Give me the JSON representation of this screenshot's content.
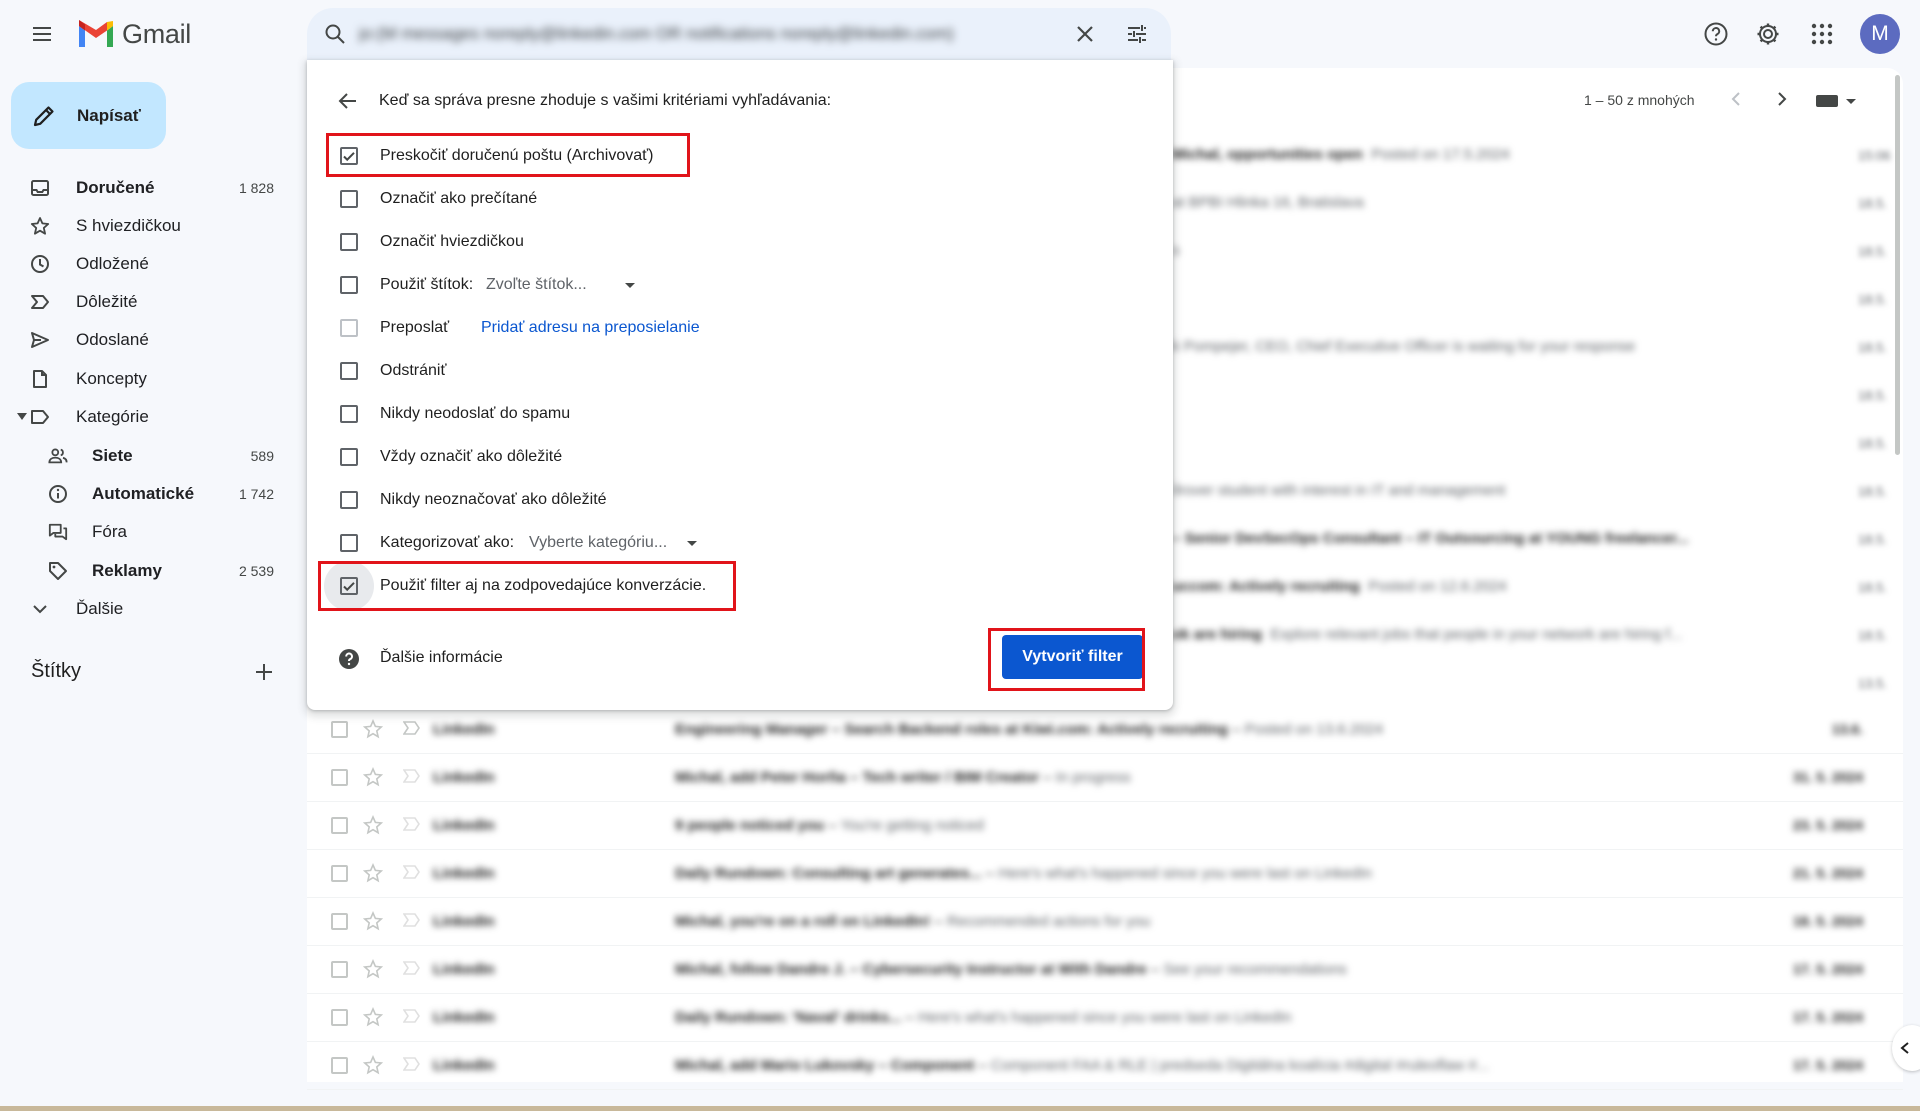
{
  "app": {
    "name": "Gmail",
    "avatar_letter": "M",
    "brand_colors": {
      "red": "#ea4335",
      "blue": "#4285f4",
      "green": "#34a853",
      "yellow": "#fbbc04"
    }
  },
  "search": {
    "value": "jo:(M messages noreply@linkedin.com OR notifications noreply@linkedin.com)"
  },
  "compose": {
    "label": "Napísať"
  },
  "sidebar": {
    "items": [
      {
        "label": "Doručené",
        "count": "1 828",
        "icon": "inbox-icon",
        "bold": true
      },
      {
        "label": "S hviezdičkou",
        "count": "",
        "icon": "star-icon"
      },
      {
        "label": "Odložené",
        "count": "",
        "icon": "clock-icon"
      },
      {
        "label": "Dôležité",
        "count": "",
        "icon": "important-icon"
      },
      {
        "label": "Odoslané",
        "count": "",
        "icon": "send-icon"
      },
      {
        "label": "Koncepty",
        "count": "",
        "icon": "draft-icon"
      },
      {
        "label": "Kategórie",
        "count": "",
        "icon": "label-icon"
      }
    ],
    "categories": [
      {
        "label": "Siete",
        "count": "589",
        "icon": "people-icon"
      },
      {
        "label": "Automatické",
        "count": "1 742",
        "icon": "info-icon"
      },
      {
        "label": "Fóra",
        "count": "",
        "icon": "forum-icon"
      },
      {
        "label": "Reklamy",
        "count": "2 539",
        "icon": "tag-icon"
      }
    ],
    "more": "Ďalšie",
    "labels_heading": "Štítky"
  },
  "list": {
    "pager": "1 – 50 z mnohých",
    "rows": [
      {
        "sender": "LinkedIn",
        "subject": "Engineering Manager – Search Backend roles at Kiwi.com: Actively recruiting",
        "snippet": "Posted on 13.6.2024",
        "date": "13.6."
      },
      {
        "sender": "LinkedIn",
        "subject": "Michal, add Peter Horňa – Tech writer / BIM Creator",
        "snippet": "In progress",
        "date": "31. 5. 2024"
      },
      {
        "sender": "LinkedIn",
        "subject": "9 people noticed you",
        "snippet": "You're getting noticed",
        "date": "23. 5. 2024"
      },
      {
        "sender": "LinkedIn",
        "subject": "Daily Rundown: Consulting art generates...",
        "snippet": "Here's what's happened since you were last on LinkedIn",
        "date": "21. 5. 2024"
      },
      {
        "sender": "LinkedIn",
        "subject": "Michal, you're on a roll on LinkedIn!",
        "snippet": "Recommended actions for you",
        "date": "18. 5. 2024"
      },
      {
        "sender": "LinkedIn",
        "subject": "Michal, follow Dandre J. – Cybersecurity Instructor at With Dandre",
        "snippet": "See your recommendations",
        "date": "17. 5. 2024"
      },
      {
        "sender": "LinkedIn",
        "subject": "Daily Rundown: 'Naval' drinks...",
        "snippet": "Here's what's happened since you were last on LinkedIn",
        "date": "17. 5. 2024"
      },
      {
        "sender": "LinkedIn",
        "subject": "Michal, add Mario Lukovsky – Component",
        "snippet": "Component FAA & RLE | predseda Digitálna koalícia #digital #ruleoflaw #...",
        "date": "17. 5. 2024"
      }
    ],
    "behind_dialog": [
      {
        "text": "Michal, opportunities open",
        "snippet": "Posted on 17.5.2024",
        "date": "15:06"
      },
      {
        "text": "at BPBI Hlinka 16, Bratislava",
        "snippet": "",
        "date": "18.5."
      },
      {
        "text": "s",
        "snippet": "",
        "date": "18.5."
      },
      {
        "text": "",
        "snippet": "",
        "date": "18.5."
      },
      {
        "text": "k Pompejer, CEO, Chief Executive Officer is waiting for your response",
        "snippet": "",
        "date": "18.5."
      },
      {
        "text": "",
        "snippet": "",
        "date": "18.5."
      },
      {
        "text": "",
        "snippet": "",
        "date": "18.5."
      },
      {
        "text": "ílrover student with interest in IT and management",
        "snippet": "",
        "date": "18.5."
      },
      {
        "text": "– Senior DevSecOps Consultant – IT Outsourcing at YOUNG freelancer...",
        "snippet": "",
        "date": "18.5."
      },
      {
        "text": "uccom: Actively recruiting",
        "snippet": "Posted on 12.6.2024",
        "date": "18.5."
      },
      {
        "text": "ok are hiring",
        "snippet": "Explore relevant jobs that people in your network are hiring f...",
        "date": "18.5."
      },
      {
        "text": "",
        "snippet": "",
        "date": "13.5."
      }
    ]
  },
  "filter_dialog": {
    "heading": "Keď sa správa presne zhoduje s vašimi kritériami vyhľadávania:",
    "options": [
      {
        "label": "Preskočiť doručenú poštu (Archivovať)",
        "checked": true
      },
      {
        "label": "Označiť ako prečítané",
        "checked": false
      },
      {
        "label": "Označiť hviezdičkou",
        "checked": false
      },
      {
        "label": "Použiť štítok:",
        "checked": false,
        "select": "Zvoľte štítok..."
      },
      {
        "label": "Preposlať",
        "checked": false,
        "link": "Pridať adresu na preposielanie"
      },
      {
        "label": "Odstrániť",
        "checked": false
      },
      {
        "label": "Nikdy neodoslať do spamu",
        "checked": false
      },
      {
        "label": "Vždy označiť ako dôležité",
        "checked": false
      },
      {
        "label": "Nikdy neoznačovať ako dôležité",
        "checked": false
      },
      {
        "label": "Kategorizovať ako:",
        "checked": false,
        "select": "Vyberte kategóriu..."
      },
      {
        "label": "Použiť filter aj na zodpovedajúce konverzácie.",
        "checked": true
      }
    ],
    "help": "Ďalšie informácie",
    "create_button": "Vytvoriť filter"
  },
  "colors": {
    "accent": "#0b57d0",
    "compose_bg": "#c2e7ff",
    "highlight": "#e1141a"
  }
}
